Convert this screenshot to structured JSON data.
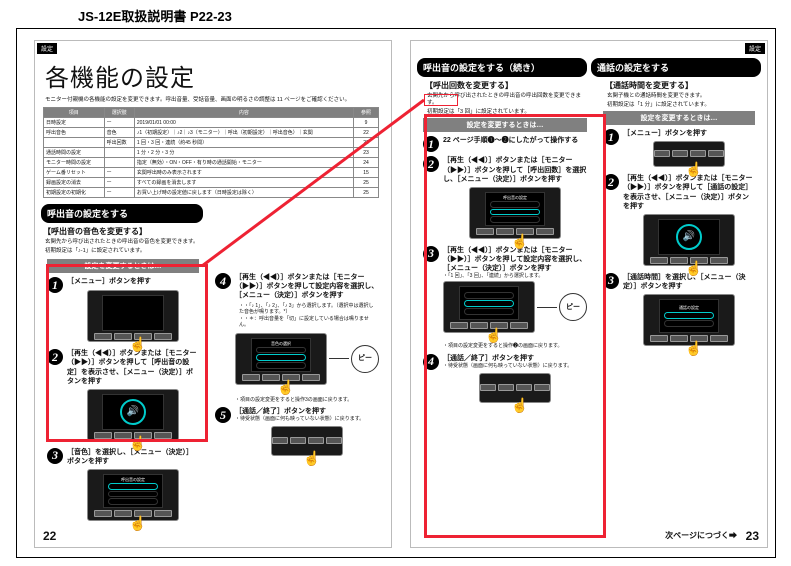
{
  "doc_title": "JS-12E取扱説明書 P22-23",
  "common": {
    "settings_tab": "設定",
    "change_settings_label": "設定を変更するときは…",
    "beep": "ピー",
    "speaker_glyph": "🔊"
  },
  "page_left": {
    "page_num": "22",
    "title": "各機能の設定",
    "subnote": "モニター付親機の各機能の設定を変更できます。呼出音量、受話音量、画面の明るさの調整は 11 ページをご確認ください。",
    "table_headers": {
      "c1": "項目",
      "c2": "選択肢",
      "c3": "内容",
      "c4": "参照"
    },
    "table_rows": [
      {
        "c1": "日時設定",
        "c2": "ー",
        "c3": "2019/01/01 00:00",
        "c4": "9"
      },
      {
        "c1": "呼出音色",
        "c2": "音色",
        "c3": "♪1（初期設定）｜♪2｜♪3（モニター）｜呼出（初期設定）｜呼出音色）｜玄関",
        "c4": "22"
      },
      {
        "c1": "",
        "c2": "呼出回数",
        "c3": "1 回・3 回・連続（約45 秒間）",
        "c4": "23"
      },
      {
        "c1": "通話時間の設定",
        "c2": "",
        "c3": "1 分・2 分・3 分",
        "c4": "23"
      },
      {
        "c1": "モニター時間の設定",
        "c2": "",
        "c3": "指定（無効）・ON・OFF・有り時の通話開始・モニター",
        "c4": "24"
      },
      {
        "c1": "ゲーム番リセット",
        "c2": "ー",
        "c3": "玄関呼出時のみ表示されます",
        "c4": "15"
      },
      {
        "c1": "録画設定の消去",
        "c2": "ー",
        "c3": "すべての録画を消去します",
        "c4": "25"
      },
      {
        "c1": "初期設定の初期化",
        "c2": "ー",
        "c3": "お買い上げ時の設定値に戻します（日時設定は除く）",
        "c4": "25"
      }
    ],
    "section_title": "呼出音の設定をする",
    "subhead": "【呼出音の音色を変更する】",
    "line1": "玄関先から呼び出されたときの呼出音の音色を変更できます。",
    "line2": "初期設定は「♪-1」に設定されています。",
    "step1": "［メニュー］ボタンを押す",
    "step2": "［再生（◀◀）］ボタンまたは［モニター（▶▶）］ボタンを押して［呼出音の設定］を表示させ、［メニュー（決定）］ボタンを押す",
    "step3": "［音色］を選択し、［メニュー（決定）］ボタンを押す",
    "step4": "［再生（◀◀）］ボタンまたは［モニター（▶▶）］ボタンを押して設定内容を選択し、［メニュー（決定）］ボタンを押す",
    "step4_note1": "・「♪ 1」、「♪ 2」、「♪ 3」から選択します。（選択中は選択した音色が鳴ります。*）",
    "step4_note2": "・＊：呼出音量を「切」に設定している場合は鳴りません。",
    "step5": "［通話／終了］ボタンを押す",
    "step5_note": "・待受状態（画面に何も映っていない状態）に戻ります。",
    "screen_title_s3": "呼出音の設定",
    "screen_title_s4": "音色の選択",
    "result_note": "・項目の設定変更をすると操作3の画面に戻ります。"
  },
  "page_right": {
    "page_num": "23",
    "continue": "次ページにつづく➡",
    "section_left": "呼出音の設定をする（続き）",
    "section_right": "通話の設定をする",
    "subhead_left": "【呼出回数を変更する】",
    "subhead_right": "【通話時間を変更する】",
    "line_l1": "玄関先から呼び出されたときの呼出音の呼出回数を変更できます。",
    "line_l2": "初期設定は「3 回」に設定されています。",
    "line_r1": "玄関子機との通話時間を変更できます。",
    "line_r2": "初期設定は「1 分」に設定されています。",
    "step_l1": "22 ページ手順❶～❷にしたがって操作する",
    "step_l2": "［再生（◀◀）］ボタンまたは［モニター（▶▶）］ボタンを押して［呼出回数］を選択し、［メニュー（決定）］ボタンを押す",
    "step_l3": "［再生（◀◀）］ボタンまたは［モニター（▶▶）］ボタンを押して設定内容を選択し、［メニュー（決定）］ボタンを押す",
    "step_l3_note": "・「1 回」、「3 回」、「連続」から選択します。",
    "step_l3_end": "・項目の設定変更をすると操作❷の画面に戻ります。",
    "step_l4": "［通話／終了］ボタンを押す",
    "step_l4_note": "・待受状態（画面に何も映っていない状態）に戻ります。",
    "step_r1": "［メニュー］ボタンを押す",
    "step_r2": "［再生（◀◀）］ボタンまたは［モニター（▶▶）］ボタンを押して［通話の設定］を表示させ、［メニュー（決定）］ボタンを押す",
    "step_r3": "［通話時間］を選択し、［メニュー（決定）］ボタンを押す",
    "screen_title_r3": "通話の設定"
  }
}
